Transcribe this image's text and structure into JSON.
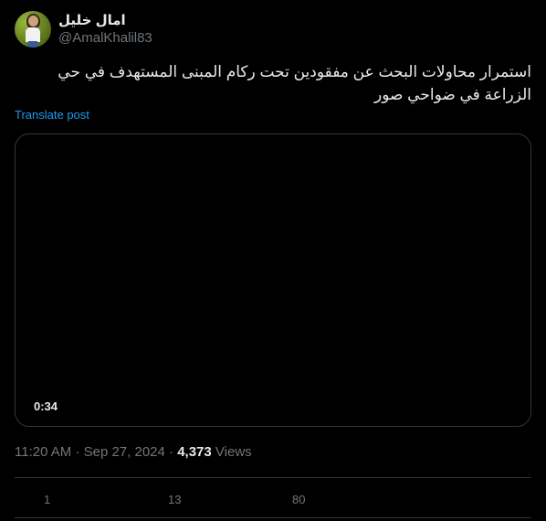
{
  "author": {
    "display_name": "امال خليل",
    "handle": "@AmalKhalil83"
  },
  "post": {
    "text": "استمرار محاولات البحث عن مفقودين تحت ركام المبنى المستهدف في حي الزراعة في ضواحي صور",
    "translate_label": "Translate post"
  },
  "media": {
    "duration": "0:34"
  },
  "meta": {
    "time": "11:20 AM",
    "separator": "·",
    "date": "Sep 27, 2024",
    "views_count": "4,373",
    "views_label": "Views"
  },
  "actions": {
    "replies": "1",
    "reposts": "13",
    "likes": "80"
  },
  "colors": {
    "background": "#000000",
    "text": "#e7e9ea",
    "muted": "#71767b",
    "link": "#1d9bf0",
    "border": "#333639"
  }
}
